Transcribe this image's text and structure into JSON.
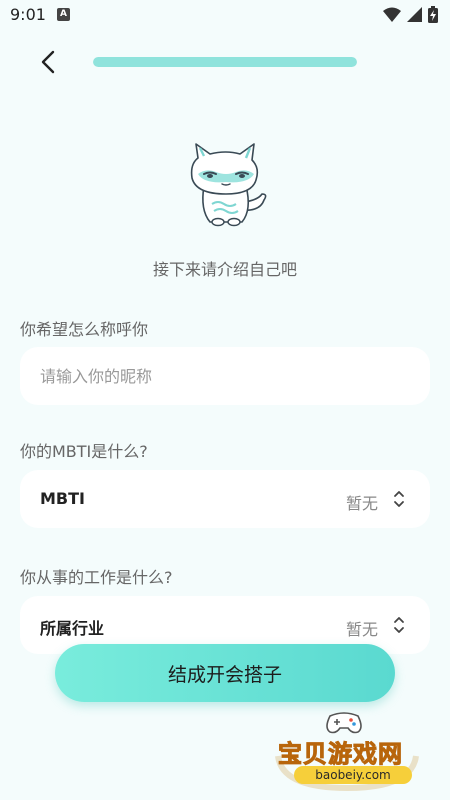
{
  "status_bar": {
    "time": "9:01",
    "app_icon_letter": "A"
  },
  "header": {
    "progress": 1.0
  },
  "intro_text": "接下来请介绍自己吧",
  "nickname": {
    "label": "你希望怎么称呼你",
    "placeholder": "请输入你的昵称",
    "value": ""
  },
  "mbti": {
    "label": "你的MBTI是什么?",
    "select_title": "MBTI",
    "select_value": "暂无"
  },
  "industry": {
    "label": "你从事的工作是什么?",
    "select_title": "所属行业",
    "select_value": "暂无"
  },
  "submit_label": "结成开会搭子",
  "watermark": {
    "name": "宝贝游戏网",
    "url": "baobeiy.com"
  },
  "colors": {
    "background": "#f4fcfc",
    "accent": "#8fe3dc",
    "button": "#5ad9d0"
  }
}
